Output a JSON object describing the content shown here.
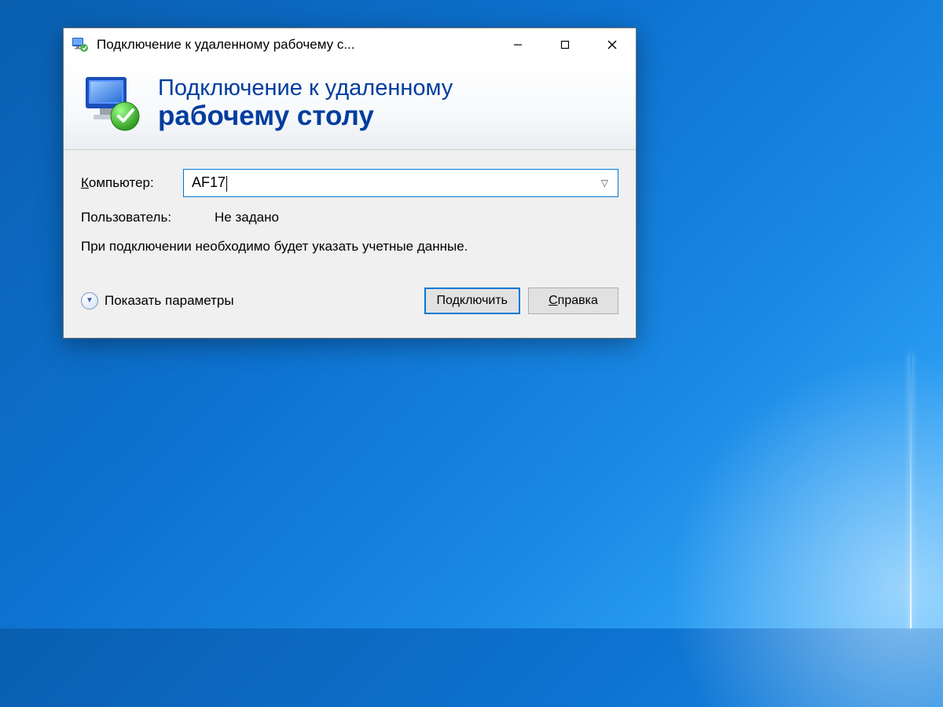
{
  "window": {
    "title": "Подключение к удаленному рабочему с..."
  },
  "header": {
    "line1": "Подключение к удаленному",
    "line2": "рабочему столу"
  },
  "form": {
    "computer_label_char": "К",
    "computer_label_rest": "омпьютер:",
    "computer_value": "AF17",
    "user_label": "Пользователь:",
    "user_value": "Не задано",
    "info_text": "При подключении необходимо будет указать учетные данные."
  },
  "footer": {
    "show_options_char": "П",
    "show_options_rest": "оказать параметры",
    "connect_label": "Подключить",
    "help_char": "С",
    "help_rest": "правка"
  }
}
